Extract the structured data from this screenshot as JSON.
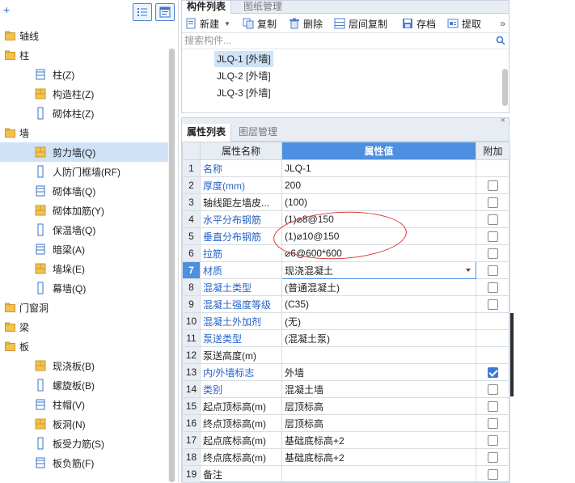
{
  "left_tree": {
    "add_icon": "+",
    "categories": [
      {
        "label": "轴线",
        "expanded": false,
        "items": []
      },
      {
        "label": "柱",
        "expanded": true,
        "items": [
          "柱(Z)",
          "构造柱(Z)",
          "砌体柱(Z)"
        ]
      },
      {
        "label": "墙",
        "expanded": true,
        "items": [
          "剪力墙(Q)",
          "人防门框墙(RF)",
          "砌体墙(Q)",
          "砌体加筋(Y)",
          "保温墙(Q)",
          "暗梁(A)",
          "墙垛(E)",
          "幕墙(Q)"
        ]
      },
      {
        "label": "门窗洞",
        "expanded": false,
        "items": []
      },
      {
        "label": "梁",
        "expanded": false,
        "items": []
      },
      {
        "label": "板",
        "expanded": true,
        "items": [
          "现浇板(B)",
          "螺旋板(B)",
          "柱帽(V)",
          "板洞(N)",
          "板受力筋(S)",
          "板负筋(F)"
        ]
      }
    ],
    "selected": "剪力墙(Q)"
  },
  "top_panel": {
    "tabs": [
      "构件列表",
      "图纸管理"
    ],
    "toolbar": {
      "new": "新建",
      "copy": "复制",
      "delete": "删除",
      "floor_copy": "层间复制",
      "save": "存档",
      "extract": "提取",
      "more": "»"
    },
    "search_placeholder": "搜索构件...",
    "components": [
      "JLQ-1 [外墙]",
      "JLQ-2 [外墙]",
      "JLQ-3 [外墙]"
    ],
    "selected_component": "JLQ-1 [外墙]"
  },
  "bottom_panel": {
    "tabs": [
      "属性列表",
      "图层管理"
    ],
    "close": "×",
    "headers": {
      "name": "属性名称",
      "value": "属性值",
      "extra": "附加"
    },
    "rows": [
      {
        "n": "1",
        "name": "名称",
        "value": "JLQ-1",
        "blue": true,
        "check": "none"
      },
      {
        "n": "2",
        "name": "厚度(mm)",
        "value": "200",
        "blue": true,
        "check": "unchecked"
      },
      {
        "n": "3",
        "name": "轴线距左墙皮...",
        "value": "(100)",
        "blue": false,
        "check": "unchecked"
      },
      {
        "n": "4",
        "name": "水平分布钢筋",
        "value": "(1)⌀8@150",
        "blue": true,
        "check": "unchecked"
      },
      {
        "n": "5",
        "name": "垂直分布钢筋",
        "value": "(1)⌀10@150",
        "blue": true,
        "check": "unchecked"
      },
      {
        "n": "6",
        "name": "拉筋",
        "value": "⌀6@600*600",
        "blue": true,
        "check": "unchecked"
      },
      {
        "n": "7",
        "name": "材质",
        "value": "现浇混凝土",
        "blue": true,
        "check": "unchecked",
        "selected": true
      },
      {
        "n": "8",
        "name": "混凝土类型",
        "value": "(普通混凝土)",
        "blue": true,
        "check": "unchecked"
      },
      {
        "n": "9",
        "name": "混凝土强度等级",
        "value": "(C35)",
        "blue": true,
        "check": "unchecked"
      },
      {
        "n": "10",
        "name": "混凝土外加剂",
        "value": "(无)",
        "blue": true,
        "check": "none"
      },
      {
        "n": "11",
        "name": "泵送类型",
        "value": "(混凝土泵)",
        "blue": true,
        "check": "none"
      },
      {
        "n": "12",
        "name": "泵送高度(m)",
        "value": "",
        "blue": false,
        "check": "none"
      },
      {
        "n": "13",
        "name": "内/外墙标志",
        "value": "外墙",
        "blue": true,
        "check": "checked"
      },
      {
        "n": "14",
        "name": "类别",
        "value": "混凝土墙",
        "blue": true,
        "check": "unchecked"
      },
      {
        "n": "15",
        "name": "起点顶标高(m)",
        "value": "层顶标高",
        "blue": false,
        "check": "unchecked"
      },
      {
        "n": "16",
        "name": "终点顶标高(m)",
        "value": "层顶标高",
        "blue": false,
        "check": "unchecked"
      },
      {
        "n": "17",
        "name": "起点底标高(m)",
        "value": "基础底标高+2",
        "blue": false,
        "check": "unchecked"
      },
      {
        "n": "18",
        "name": "终点底标高(m)",
        "value": "基础底标高+2",
        "blue": false,
        "check": "unchecked"
      },
      {
        "n": "19",
        "name": "备注",
        "value": "",
        "blue": false,
        "check": "unchecked"
      }
    ]
  },
  "colors": {
    "accent": "#4d8fe0",
    "link_blue": "#2763c7",
    "selection": "#cfe2f7",
    "annotation": "#d9383a"
  }
}
